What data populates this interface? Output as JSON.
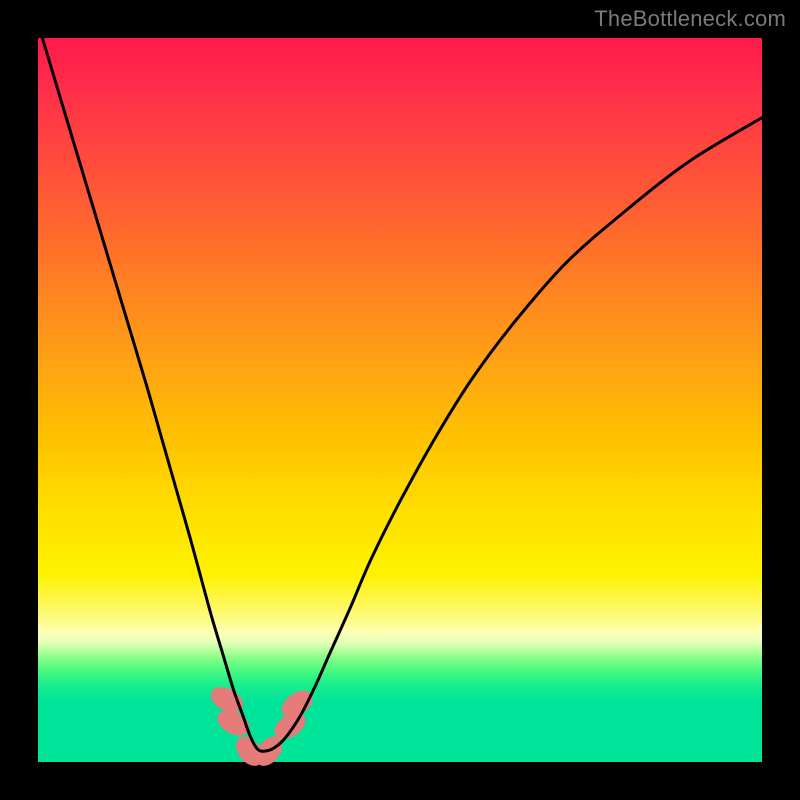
{
  "watermark": "TheBottleneck.com",
  "chart_data": {
    "type": "line",
    "title": "",
    "xlabel": "",
    "ylabel": "",
    "xlim": [
      0,
      100
    ],
    "ylim": [
      0,
      100
    ],
    "series": [
      {
        "name": "bottleneck-curve",
        "x": [
          0,
          3,
          6,
          9,
          12,
          15,
          17,
          19,
          21,
          22.5,
          24,
          25.5,
          27,
          28.3,
          29.3,
          30.3,
          31.3,
          32.7,
          34.3,
          36.3,
          38.3,
          40.3,
          43,
          46,
          50,
          55,
          60,
          66,
          73,
          81,
          90,
          100
        ],
        "values": [
          102,
          92,
          82,
          72,
          62,
          52,
          45,
          38,
          31,
          25.5,
          20,
          15,
          10,
          6.4,
          3.6,
          1.8,
          1.5,
          2.0,
          3.5,
          6.5,
          10.5,
          15.0,
          21,
          28,
          36,
          45,
          53,
          61,
          69,
          76,
          83,
          89
        ],
        "color": "#000000",
        "linewidth": 3
      }
    ],
    "markers": [
      {
        "cx": 26.1,
        "cy": 8.6,
        "rx": 1.5,
        "ry": 2.4,
        "angle": -62,
        "color": "#e57c7a"
      },
      {
        "cx": 27.0,
        "cy": 5.4,
        "rx": 1.5,
        "ry": 2.4,
        "angle": -62,
        "color": "#e57c7a"
      },
      {
        "cx": 29.2,
        "cy": 1.5,
        "rx": 1.5,
        "ry": 2.3,
        "angle": -38,
        "color": "#e57c7a"
      },
      {
        "cx": 31.9,
        "cy": 1.5,
        "rx": 1.5,
        "ry": 2.3,
        "angle": 38,
        "color": "#e57c7a"
      },
      {
        "cx": 34.8,
        "cy": 5.0,
        "rx": 1.5,
        "ry": 2.4,
        "angle": 55,
        "color": "#e57c7a"
      },
      {
        "cx": 35.8,
        "cy": 8.0,
        "rx": 1.5,
        "ry": 2.4,
        "angle": 55,
        "color": "#e57c7a"
      }
    ],
    "gradient_stops": [
      {
        "pos": 0,
        "color": "#ff1a4b"
      },
      {
        "pos": 56,
        "color": "#ffc400"
      },
      {
        "pos": 82,
        "color": "#ffffb5"
      },
      {
        "pos": 100,
        "color": "#00e49a"
      }
    ]
  }
}
